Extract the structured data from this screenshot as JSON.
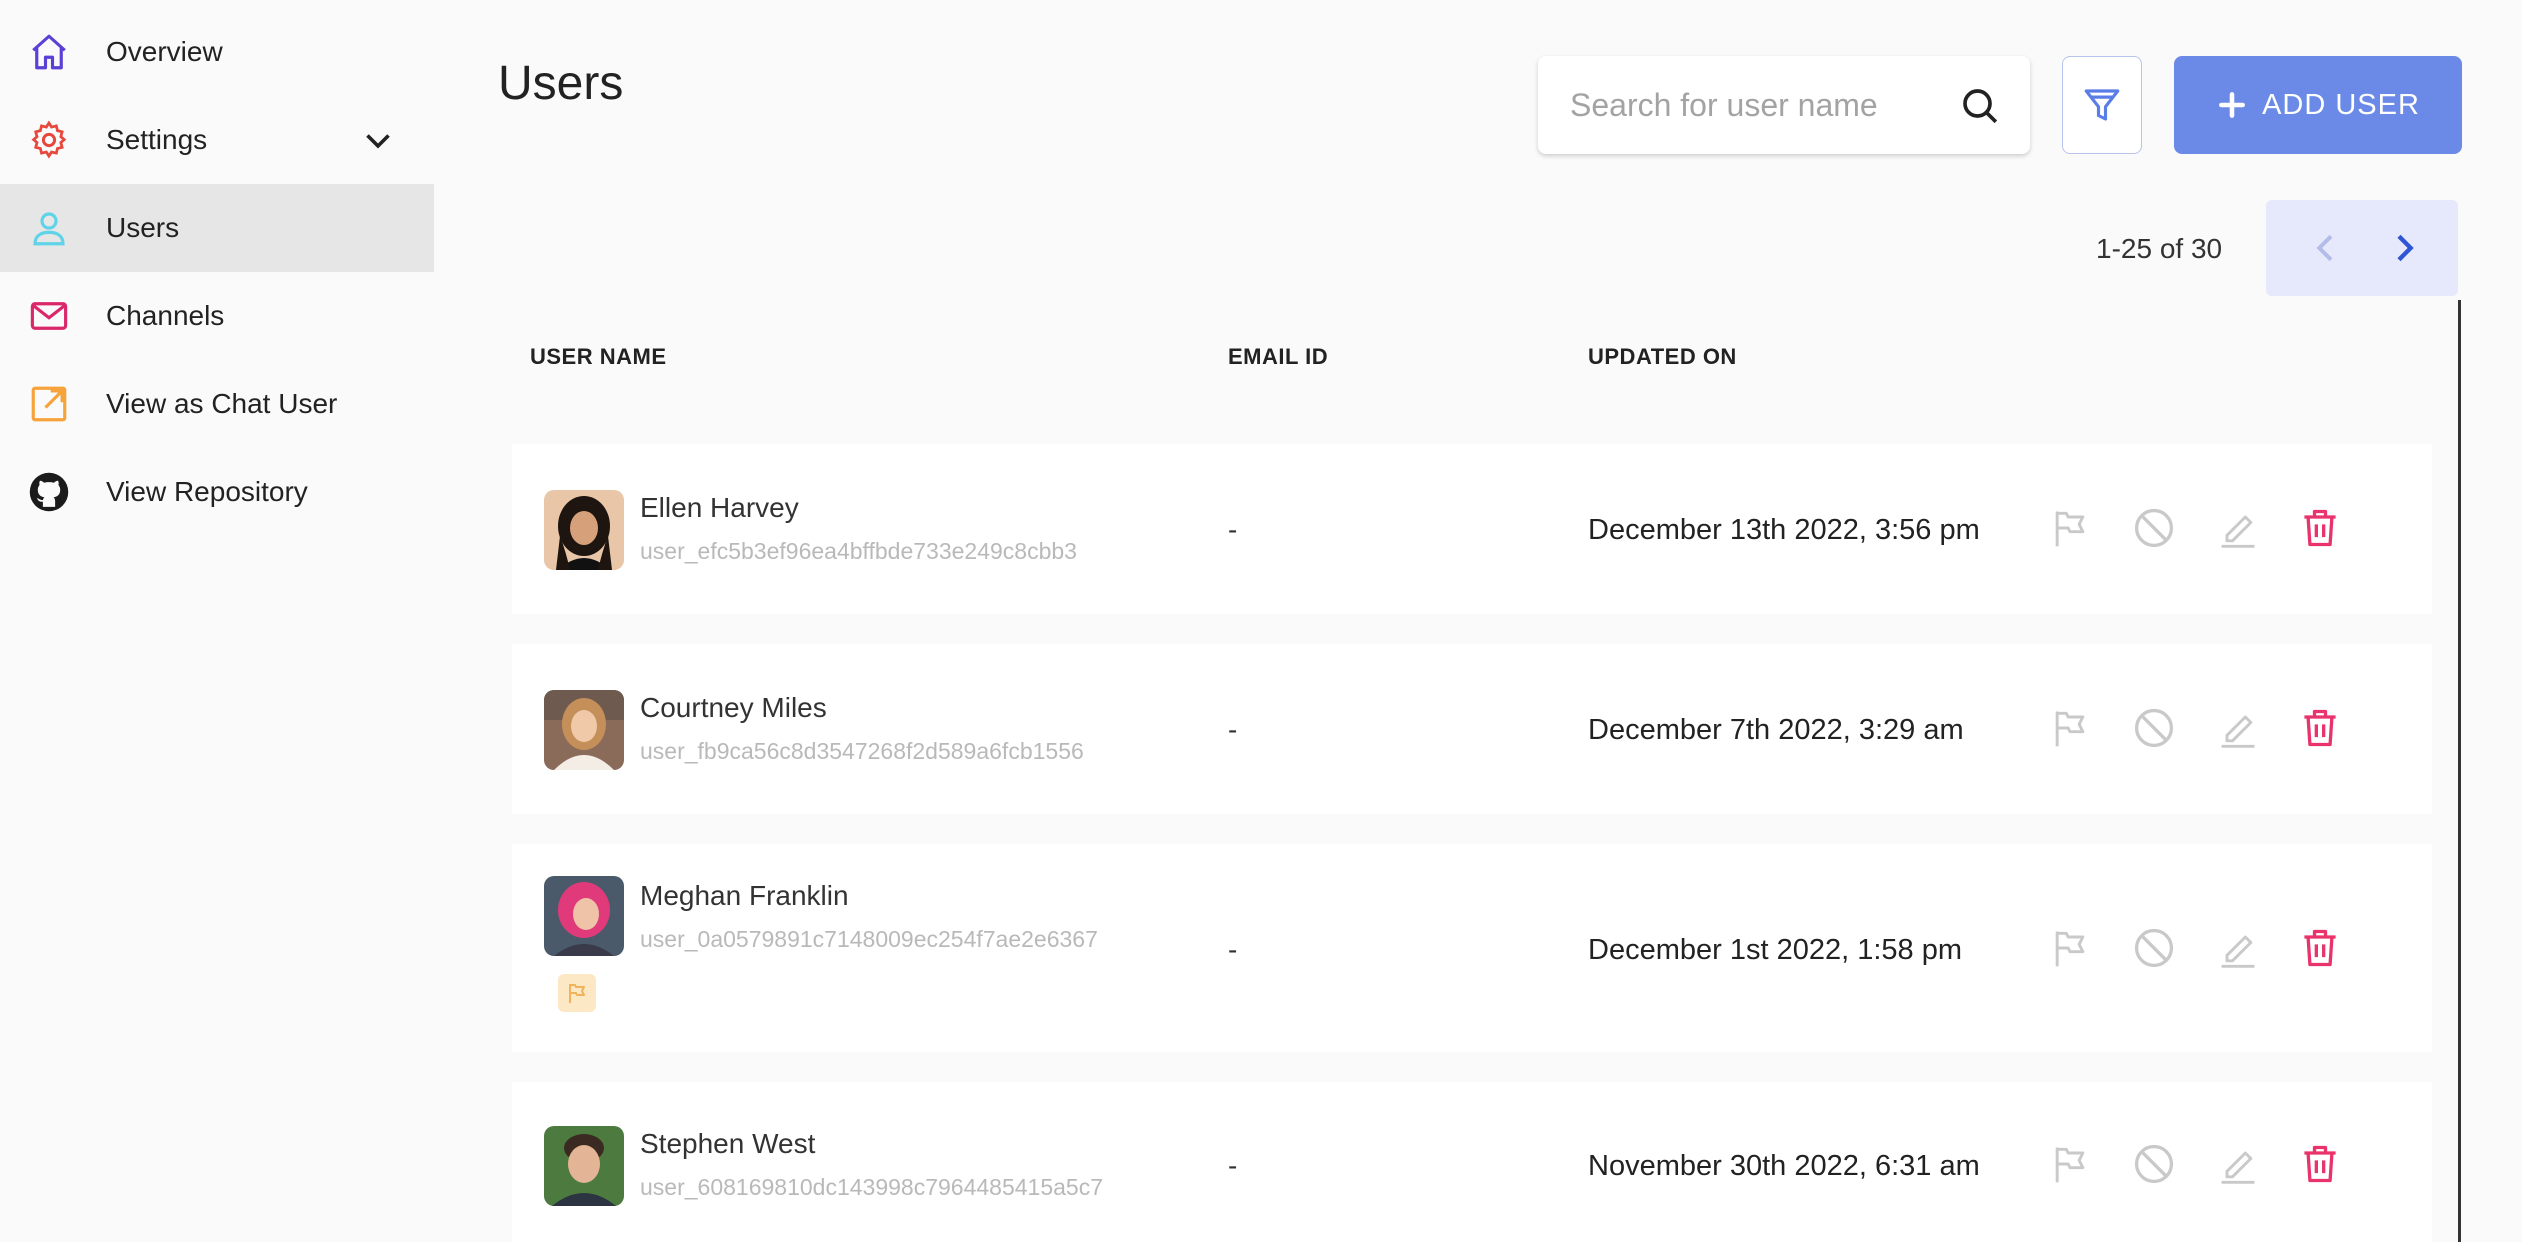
{
  "sidebar": {
    "items": [
      {
        "label": "Overview",
        "icon": "home-icon",
        "color": "#5b3fd6"
      },
      {
        "label": "Settings",
        "icon": "gear-icon",
        "color": "#e8473b"
      },
      {
        "label": "Users",
        "icon": "user-icon",
        "color": "#5fd3e8",
        "active": true
      },
      {
        "label": "Channels",
        "icon": "mail-icon",
        "color": "#d9276a"
      },
      {
        "label": "View as Chat User",
        "icon": "external-link-icon",
        "color": "#f5a33a"
      },
      {
        "label": "View Repository",
        "icon": "github-icon",
        "color": "#1b1b1b"
      }
    ]
  },
  "header": {
    "title": "Users",
    "search_placeholder": "Search for user name",
    "add_user_label": "ADD USER",
    "accent": "#6b8ae8"
  },
  "pagination": {
    "info": "1-25 of 30"
  },
  "table": {
    "columns": [
      "USER NAME",
      "EMAIL ID",
      "UPDATED ON"
    ],
    "rows": [
      {
        "name": "Ellen Harvey",
        "id": "user_efc5b3ef96ea4bffbde733e249c8cbb3",
        "email": "-",
        "updated": "December 13th 2022, 3:56 pm",
        "flagged": false
      },
      {
        "name": "Courtney Miles",
        "id": "user_fb9ca56c8d3547268f2d589a6fcb1556",
        "email": "-",
        "updated": "December 7th 2022, 3:29 am",
        "flagged": false
      },
      {
        "name": "Meghan Franklin",
        "id": "user_0a0579891c7148009ec254f7ae2e6367",
        "email": "-",
        "updated": "December 1st 2022, 1:58 pm",
        "flagged": true
      },
      {
        "name": "Stephen West",
        "id": "user_608169810dc143998c7964485415a5c7",
        "email": "-",
        "updated": "November 30th 2022, 6:31 am",
        "flagged": false
      }
    ]
  }
}
